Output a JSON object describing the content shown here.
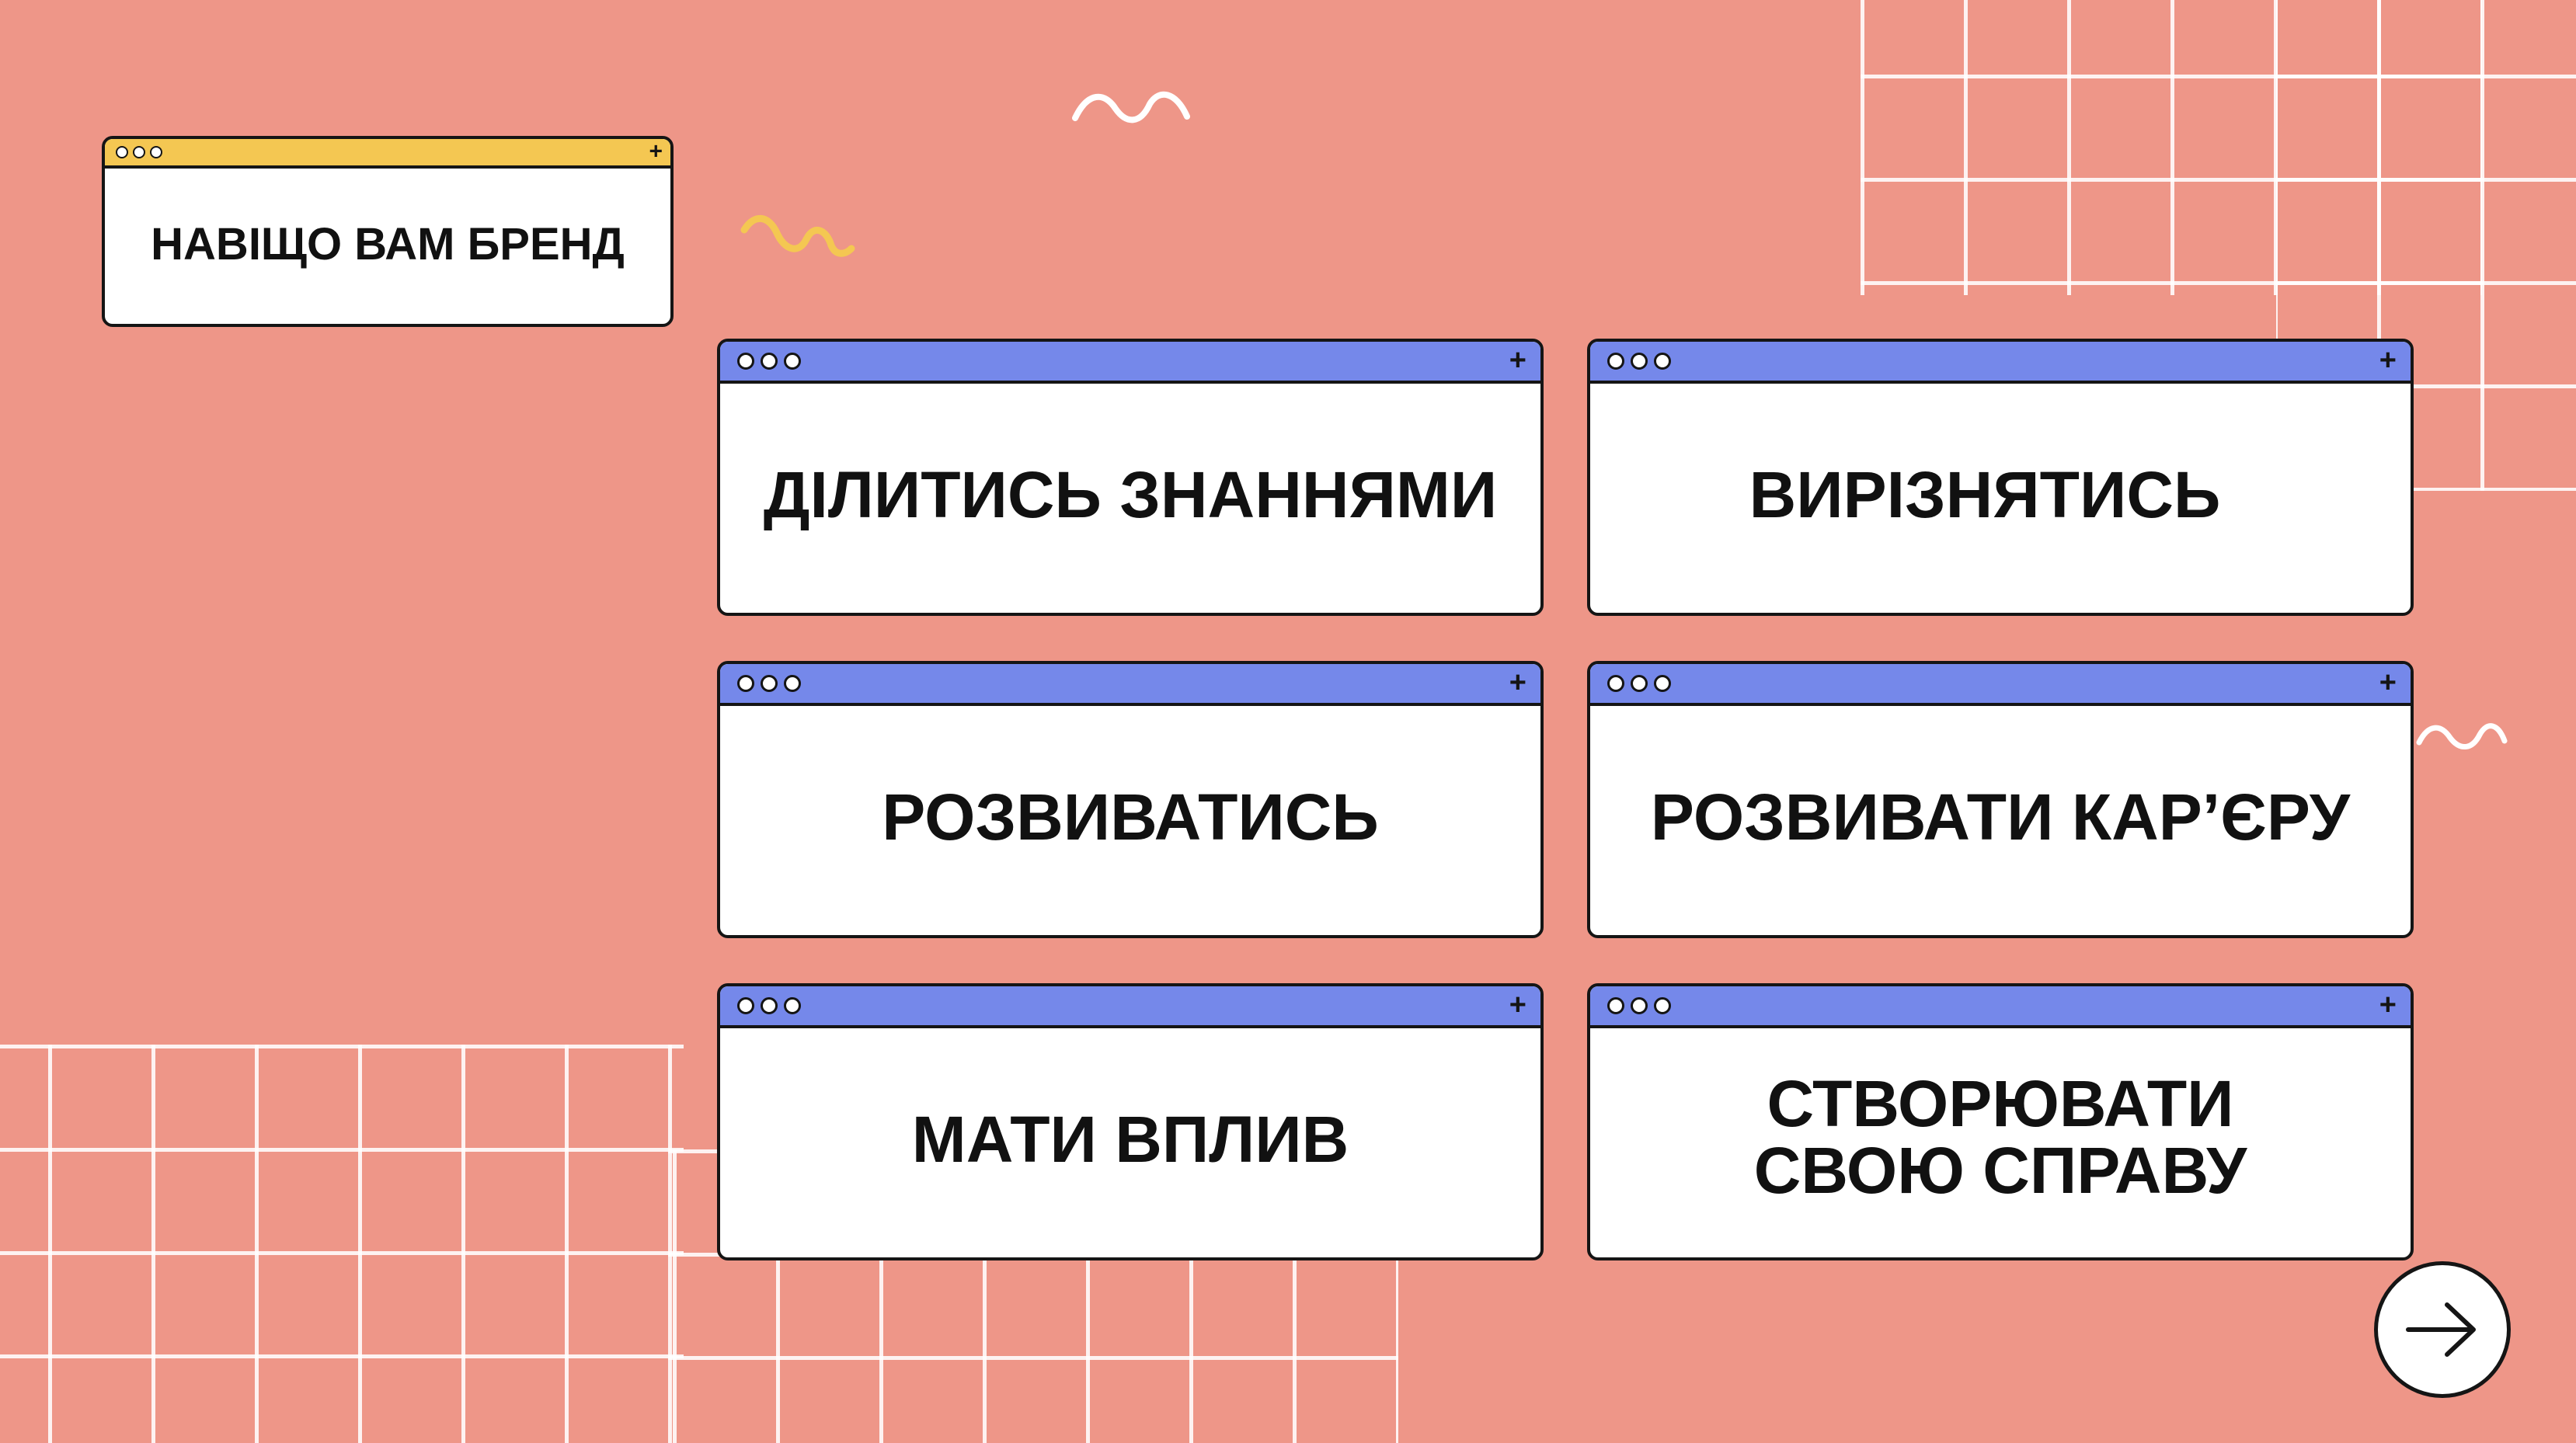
{
  "title_window": {
    "label": "НАВІЩО ВАМ БРЕНД"
  },
  "cards": [
    {
      "label": "ДІЛИТИСЬ ЗНАННЯМИ"
    },
    {
      "label": "ВИРІЗНЯТИСЬ"
    },
    {
      "label": "РОЗВИВАТИСЬ"
    },
    {
      "label": "РОЗВИВАТИ КАР’ЄРУ"
    },
    {
      "label": "МАТИ ВПЛИВ"
    },
    {
      "label": "СТВОРЮВАТИ СВОЮ СПРАВУ"
    }
  ],
  "icons": {
    "window_dots": "three-dots-icon",
    "window_add": "plus-icon",
    "next": "arrow-right-icon"
  },
  "colors": {
    "background": "#ee9688",
    "grid_lines": "#ffffff",
    "title_bar_yellow": "#f4c752",
    "card_bar_blue": "#7588ea",
    "squiggle_yellow": "#f4c752",
    "squiggle_white": "#ffffff"
  }
}
